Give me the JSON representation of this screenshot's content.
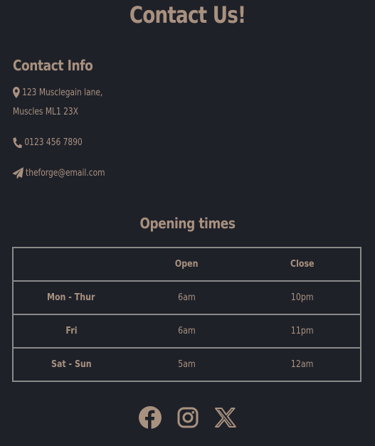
{
  "page": {
    "title": "Contact Us!"
  },
  "contact": {
    "heading": "Contact Info",
    "address_line1": "123 Musclegain lane,",
    "address_line2": "Muscles ML1 23X",
    "phone": "0123 456 7890",
    "email": "theforge@email.com",
    "icons": [
      "map-marker-icon",
      "phone-icon",
      "paper-plane-icon"
    ]
  },
  "hours": {
    "heading": "Opening times",
    "columns": [
      "",
      "Open",
      "Close"
    ],
    "rows": [
      {
        "day": "Mon - Thur",
        "open": "6am",
        "close": "10pm"
      },
      {
        "day": "Fri",
        "open": "6am",
        "close": "11pm"
      },
      {
        "day": "Sat - Sun",
        "open": "5am",
        "close": "12am"
      }
    ]
  },
  "social": {
    "icons": [
      "facebook-icon",
      "instagram-icon",
      "x-twitter-icon"
    ]
  },
  "colors": {
    "background": "#1f2129",
    "accent": "#a8917f",
    "border": "#8a8a8a"
  }
}
